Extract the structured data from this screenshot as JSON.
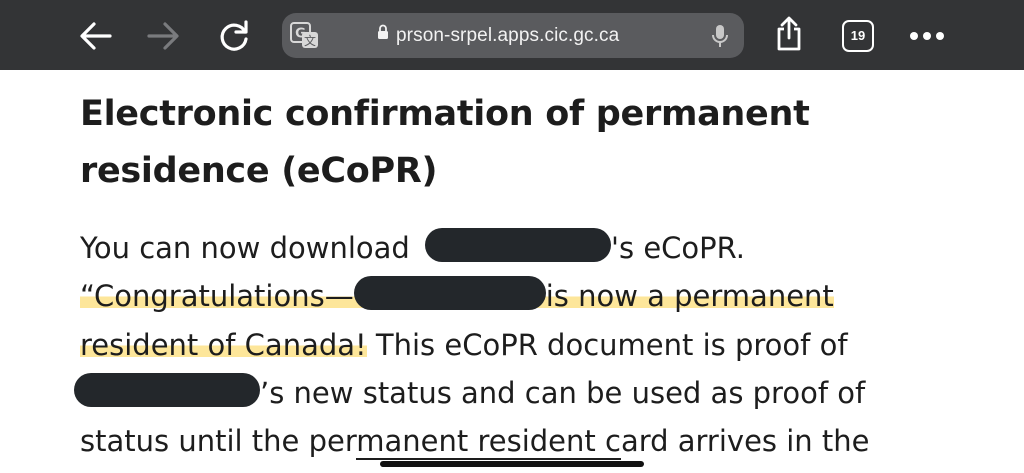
{
  "browser": {
    "url": "prson-srpel.apps.cic.gc.ca",
    "tab_count": "19",
    "toolbar_color": "#333436",
    "urlbar_color": "#5a5b5e",
    "icons": [
      "back-arrow-icon",
      "forward-arrow-icon",
      "reload-icon",
      "translate-icon",
      "lock-icon",
      "microphone-icon",
      "share-icon",
      "tabs-icon",
      "more-icon"
    ]
  },
  "page": {
    "heading": "Electronic confirmation of permanent residence (eCoPR)",
    "line1": {
      "before": "You can now download",
      "after": "'s eCoPR."
    },
    "line2": {
      "before": "“Congratulations—",
      "after": "is now a permanent"
    },
    "line3": {
      "highlighted": "resident of Canada!",
      "after": " This eCoPR document is proof of"
    },
    "line4": {
      "after": "’s new status and can be used as proof of"
    },
    "line5": {
      "before": "status until the per",
      "underlined": "manent resident c",
      "after": "ard arrives in the"
    },
    "highlight_color": "#fde69a",
    "redaction_color": "#23272b"
  }
}
